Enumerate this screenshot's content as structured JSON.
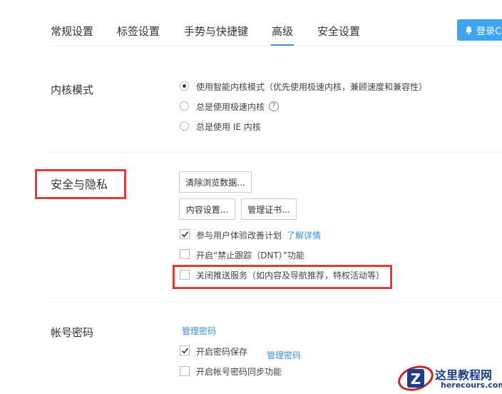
{
  "tabs": [
    {
      "label": "常规设置",
      "active": false
    },
    {
      "label": "标签设置",
      "active": false
    },
    {
      "label": "手势与快捷键",
      "active": false
    },
    {
      "label": "高级",
      "active": true
    },
    {
      "label": "安全设置",
      "active": false
    }
  ],
  "login_button": {
    "label": "登录C",
    "icon": "bell-icon"
  },
  "kernel_mode": {
    "title": "内核模式",
    "options": [
      {
        "label": "使用智能内核模式（优先使用极速内核，兼顾速度和兼容性）",
        "selected": true
      },
      {
        "label": "总是使用极速内核",
        "selected": false,
        "help": "?"
      },
      {
        "label": "总是使用 IE 内核",
        "selected": false
      }
    ]
  },
  "security_privacy": {
    "title": "安全与隐私",
    "buttons": {
      "clear_data": "清除浏览数据...",
      "content_settings": "内容设置...",
      "manage_certs": "管理证书..."
    },
    "checkboxes": [
      {
        "label": "参与用户体验改善计划",
        "checked": true,
        "link": "了解详情"
      },
      {
        "label": "开启“禁止跟踪（DNT）”功能",
        "checked": false
      },
      {
        "label": "关闭推送服务（如内容及导航推荐，特权活动等）",
        "checked": false
      }
    ]
  },
  "account_password": {
    "title": "帐号密码",
    "manage_link": "管理密码",
    "checkboxes": [
      {
        "label": "开启密码保存",
        "checked": true,
        "link": "管理密码"
      },
      {
        "label": "开启帐号密码同步功能",
        "checked": false
      }
    ]
  },
  "watermark": {
    "title": "这里教程网",
    "url": "herecours.com",
    "logo_letter": "Z"
  },
  "colors": {
    "accent": "#3a8ee6",
    "highlight": "#e03b3b",
    "login_bg": "#3ea6f0"
  }
}
